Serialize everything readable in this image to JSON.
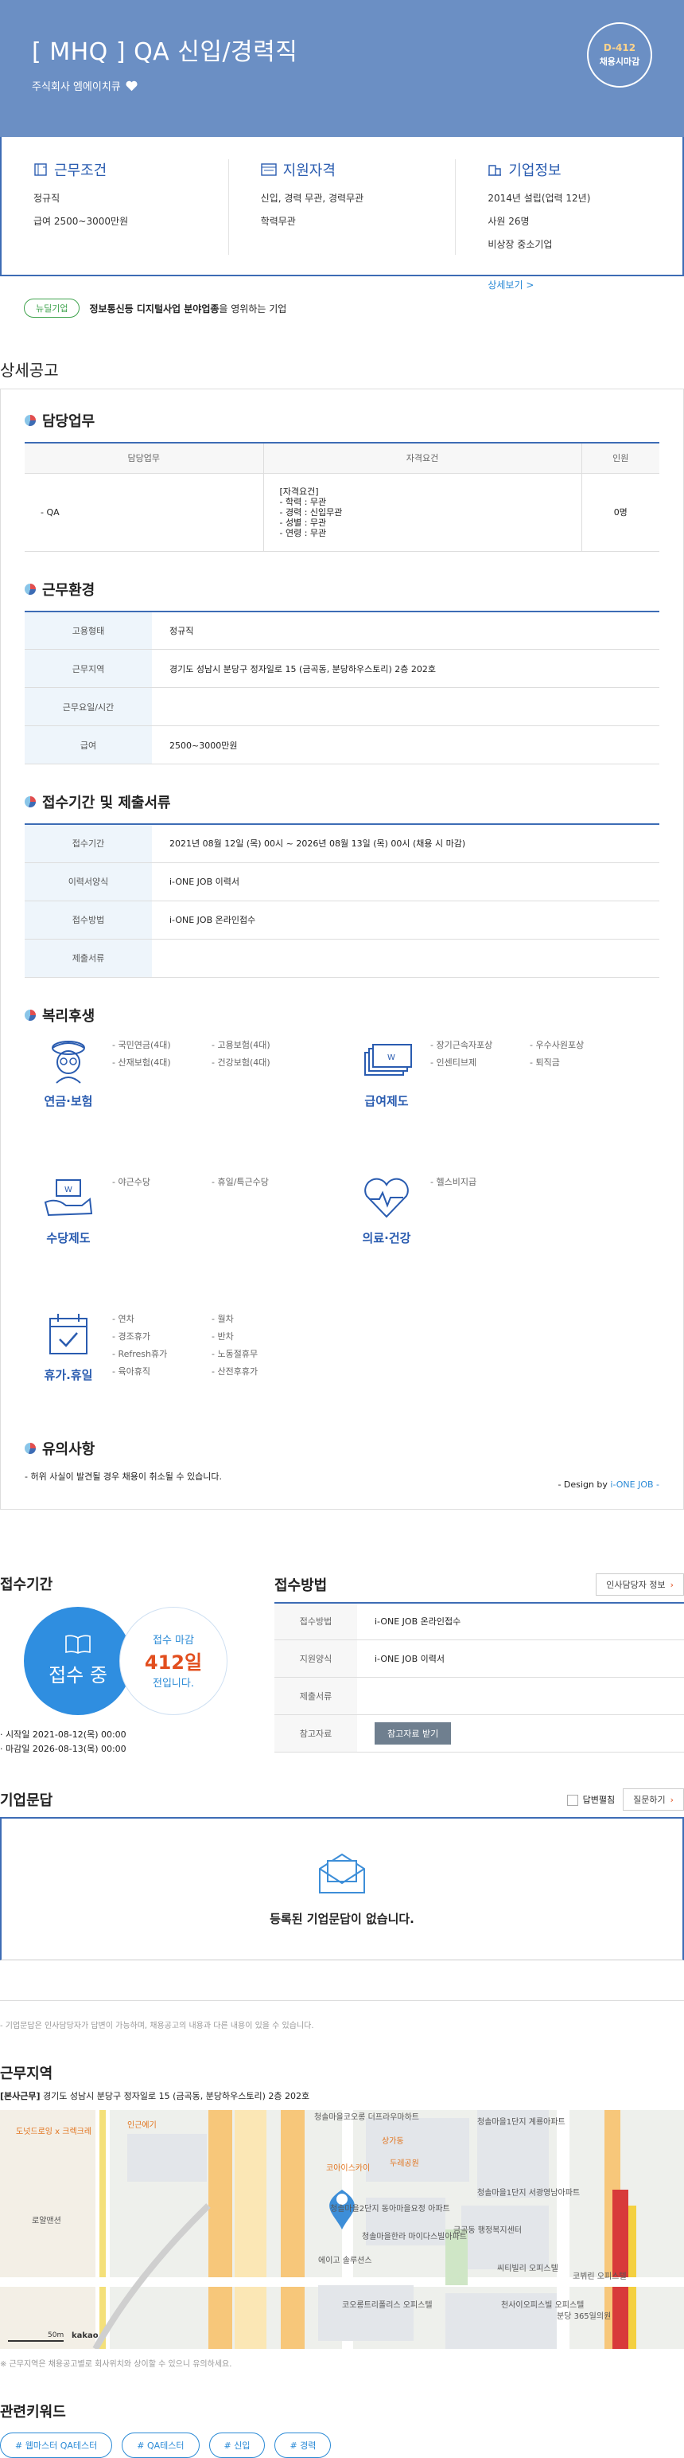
{
  "header": {
    "title": "[ MHQ ] QA 신입/경력직",
    "company": "주식회사 엠에이치큐",
    "dday": "D-412",
    "dday_label": "채용시마감"
  },
  "summary": {
    "work": {
      "title": "근무조건",
      "lines": [
        "정규직",
        "급여 2500~3000만원"
      ]
    },
    "qual": {
      "title": "지원자격",
      "lines": [
        "신입, 경력 무관, 경력무관",
        "학력무관"
      ]
    },
    "corp": {
      "title": "기업정보",
      "lines": [
        "2014년 설립(업력 12년)",
        "사원 26명",
        "비상장 중소기업"
      ],
      "more": "상세보기 >"
    }
  },
  "badge": {
    "pill": "뉴딜기업",
    "text_bold": "정보통신등 디지털사업 분야업종",
    "text_rest": "을 영위하는 기업"
  },
  "detail_title": "상세공고",
  "duty": {
    "title": "담당업무",
    "headers": [
      "담당업무",
      "자격요건",
      "인원"
    ],
    "task": "- QA",
    "req_head": "[자격요건]",
    "req_lines": [
      "- 학력 : 무관",
      "- 경력 : 신입무관",
      "- 성별 : 무관",
      "- 연령 : 무관"
    ],
    "count": "0명"
  },
  "env": {
    "title": "근무환경",
    "rows": [
      {
        "k": "고용형태",
        "v": "정규직"
      },
      {
        "k": "근무지역",
        "v": "경기도 성남시 분당구 정자일로 15 (금곡동, 분당하우스토리) 2층 202호"
      },
      {
        "k": "근무요일/시간",
        "v": ""
      },
      {
        "k": "급여",
        "v": "2500~3000만원"
      }
    ]
  },
  "period": {
    "title": "접수기간 및 제출서류",
    "rows": [
      {
        "k": "접수기간",
        "v": "2021년 08월 12일 (목) 00시 ~ 2026년 08월 13일 (목) 00시 (채용 시 마감)"
      },
      {
        "k": "이력서양식",
        "v": "i-ONE JOB 이력서"
      },
      {
        "k": "접수방법",
        "v": "i-ONE JOB 온라인접수"
      },
      {
        "k": "제출서류",
        "v": ""
      }
    ]
  },
  "welfare": {
    "title": "복리후생",
    "items": [
      {
        "label": "연금·보험",
        "icon": "pension-icon",
        "list": [
          "- 국민연금(4대)",
          "- 고용보험(4대)",
          "- 산재보험(4대)",
          "- 건강보험(4대)"
        ]
      },
      {
        "label": "급여제도",
        "icon": "salary-icon",
        "list": [
          "- 장기근속자포상",
          "- 우수사원포상",
          "- 인센티브제",
          "- 퇴직금"
        ]
      },
      {
        "label": "수당제도",
        "icon": "allowance-icon",
        "list": [
          "- 야근수당",
          "- 휴일/특근수당"
        ]
      },
      {
        "label": "의료·건강",
        "icon": "health-icon",
        "list": [
          "- 헬스비지급"
        ]
      },
      {
        "label": "휴가.휴일",
        "icon": "vacation-icon",
        "list": [
          "- 연차",
          "- 월차",
          "- 경조휴가",
          "- 반차",
          "- Refresh휴가",
          "- 노동절휴무",
          "- 육아휴직",
          "- 산전후휴가"
        ]
      }
    ]
  },
  "caution": {
    "title": "유의사항",
    "text": "- 허위 사실이 발견될 경우 채용이 취소될 수 있습니다.",
    "design_prefix": "- Design by ",
    "design_brand": "i-ONE JOB -"
  },
  "apply_period": {
    "title": "접수기간",
    "status": "접수 중",
    "deadline_label": "접수 마감",
    "days": "412일",
    "days_suffix": "전입니다.",
    "start": "· 시작일 2021-08-12(목) 00:00",
    "end": "· 마감일 2026-08-13(목) 00:00"
  },
  "apply_method": {
    "title": "접수방법",
    "contact_btn": "인사담당자 정보",
    "rows": [
      {
        "k": "접수방법",
        "v": "i-ONE JOB 온라인접수"
      },
      {
        "k": "지원양식",
        "v": "i-ONE JOB 이력서"
      },
      {
        "k": "제출서류",
        "v": ""
      },
      {
        "k": "참고자료",
        "v": ""
      }
    ],
    "ref_btn": "참고자료 받기"
  },
  "qa": {
    "title": "기업문답",
    "toggle": "답변펼침",
    "ask": "질문하기",
    "empty": "등록된 기업문답이 없습니다.",
    "note": "- 기업문답은 인사담당자가 답변이 가능하며, 채용공고의 내용과 다른 내용이 있을 수 있습니다."
  },
  "location": {
    "title": "근무지역",
    "label": "[본사근무]",
    "address": "경기도 성남시 분당구 정자일로 15 (금곡동, 분당하우스토리) 2층 202호",
    "note": "※ 근무지역은 채용공고별로 회사위치와 상이할 수 있으니 유의하세요.",
    "map_labels": [
      "도넛드로잉 x 크렉크레",
      "인근에기",
      "청솔마을코오롱 더프라우마하트",
      "청솔마을1단지 계룡아파트",
      "상가동",
      "두레공원",
      "코아이스카이",
      "로얄맨션",
      "청솔마을1단지 서광영남아파트",
      "청솔마을2단지 동아마을요정 아파트",
      "금곡동 행정복지센터",
      "에이고 솔루션스",
      "청솔마을한라 마이다스빌아파트",
      "씨티빌리 오피스텔",
      "코오롱트리폴리스 오피스텔",
      "천사이오피스빌 오피스텔",
      "분당 365일의원",
      "코뷔린 오피스텔",
      "50m",
      "kakao"
    ]
  },
  "keywords": {
    "title": "관련키워드",
    "items": [
      "# 웹마스터 QA테스터",
      "# QA테스터",
      "# 신입",
      "# 경력"
    ]
  }
}
